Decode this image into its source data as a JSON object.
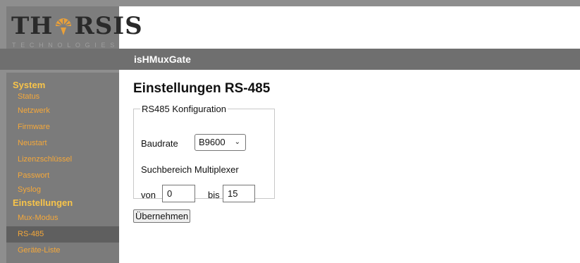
{
  "logo": {
    "word_left": "TH",
    "word_right": "RSIS",
    "subtitle": "TECHNOLOGIES"
  },
  "header": {
    "title": "isHMuxGate"
  },
  "sidebar": {
    "system_heading": "System",
    "system_items": [
      "Status",
      "Netzwerk",
      "Firmware",
      "Neustart",
      "Lizenzschlüssel",
      "Passwort",
      "Syslog"
    ],
    "settings_heading": "Einstellungen",
    "settings_items": [
      "Mux-Modus",
      "RS-485",
      "Geräte-Liste"
    ],
    "active_item": "RS-485"
  },
  "main": {
    "page_title": "Einstellungen RS-485",
    "fieldset_legend": "RS485 Konfiguration",
    "baudrate_label": "Baudrate",
    "baudrate_value": "B9600",
    "multiplexer_label": "Suchbereich Multiplexer",
    "from_label": "von",
    "from_value": "0",
    "to_label": "bis",
    "to_value": "15",
    "apply_button": "Übernehmen"
  },
  "colors": {
    "sidebar_bg": "#7b7b7b",
    "header_bg": "#6f6f6f",
    "section_text": "#f8c44a",
    "item_text": "#f5a83a",
    "active_bg": "#5f5f5f"
  }
}
